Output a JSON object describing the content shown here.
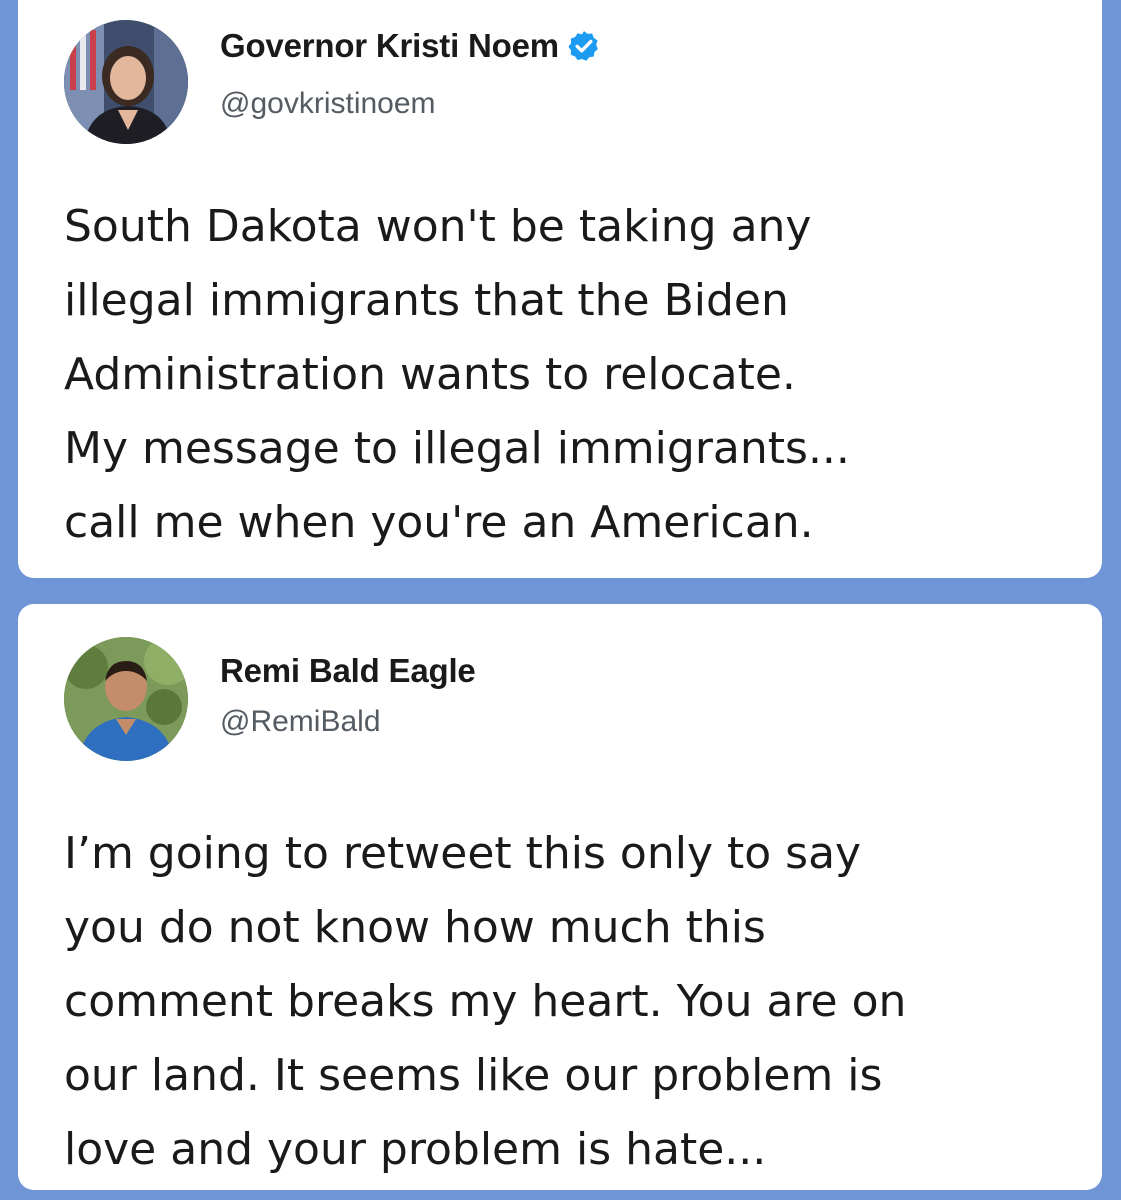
{
  "tweets": [
    {
      "name": "Governor Kristi Noem",
      "handle": "@govkristinoem",
      "verified": true,
      "lines": [
        "South Dakota won't be taking any",
        "illegal immigrants that the Biden",
        "Administration wants to relocate.",
        "My message to illegal immigrants...",
        "call me when you're an American."
      ]
    },
    {
      "name": "Remi Bald Eagle",
      "handle": "@RemiBald",
      "verified": false,
      "lines": [
        "I’m going to retweet this only to say",
        "you do not know how much this",
        "comment breaks my heart. You are on",
        "our land. It seems like our problem is",
        "love and your problem is hate..."
      ]
    }
  ],
  "colors": {
    "background": "#6f95d6",
    "card": "#ffffff",
    "verified_badge": "#1d9bf0"
  }
}
